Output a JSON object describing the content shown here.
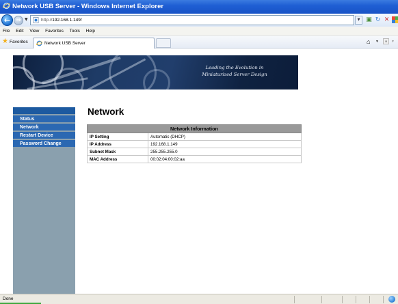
{
  "window": {
    "title": "Network USB Server - Windows Internet Explorer"
  },
  "navigation": {
    "address": "http://192.168.1.149/",
    "address_prefix": "http://",
    "address_host": "192.168.1.149/"
  },
  "menu": {
    "items": [
      "File",
      "Edit",
      "View",
      "Favorites",
      "Tools",
      "Help"
    ]
  },
  "favorites_bar": {
    "favorites_label": "Favorites",
    "tab_title": "Network USB Server"
  },
  "banner": {
    "tagline_line1": "Leading the Evolution in",
    "tagline_line2": "Miniaturized Server Design"
  },
  "sidebar": {
    "items": [
      {
        "label": "Status"
      },
      {
        "label": "Network"
      },
      {
        "label": "Restart Device"
      },
      {
        "label": "Password Change"
      }
    ]
  },
  "page": {
    "title": "Network"
  },
  "network_info": {
    "header": "Network Information",
    "rows": [
      {
        "key": "IP Setting",
        "value": "Automatic (DHCP)"
      },
      {
        "key": "IP Address",
        "value": "192.168.1.149"
      },
      {
        "key": "Subnet Mask",
        "value": "255.255.255.0"
      },
      {
        "key": "MAC Address",
        "value": "00:02:04:00:02:aa"
      }
    ]
  },
  "status": {
    "text": "Done"
  },
  "colors": {
    "sidebar_bg": "#8aa0ae",
    "menu_item_bg": "#2b68b2",
    "table_header_bg": "#999999",
    "titlebar_blue": "#1f5fd4"
  }
}
